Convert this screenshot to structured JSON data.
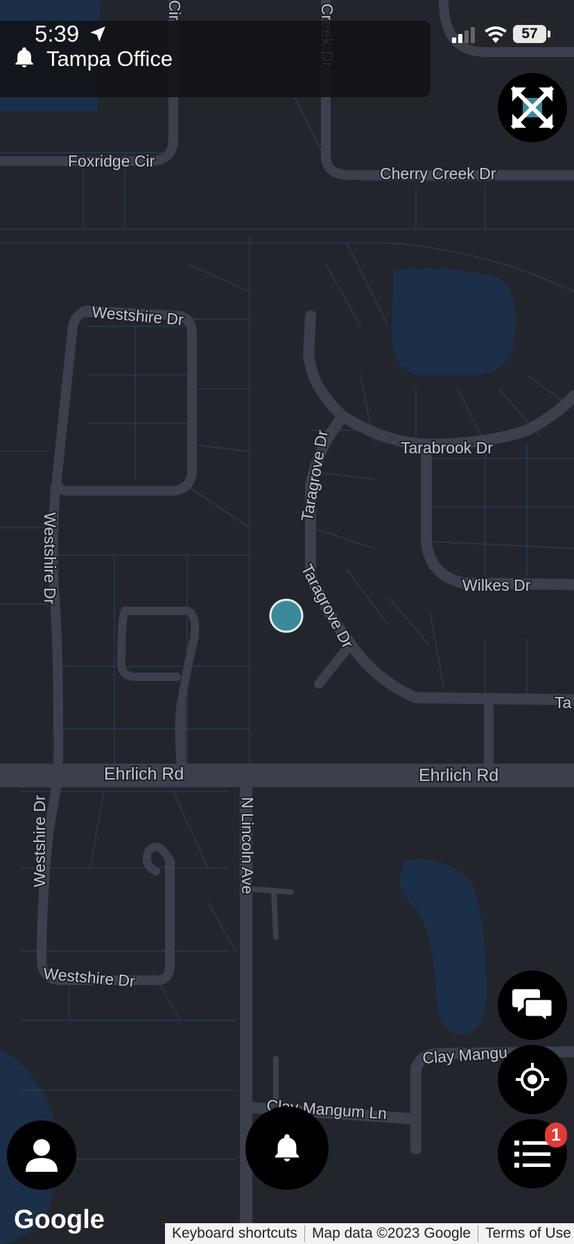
{
  "status_bar": {
    "time": "5:39",
    "battery": "57"
  },
  "header": {
    "title": "Tampa Office"
  },
  "map": {
    "roads": {
      "cir_top": "Cir",
      "creek_dr": "Creek Dr",
      "foxridge_cir": "Foxridge Cir",
      "cherry_creek_dr": "Cherry Creek Dr",
      "westshire_dr_top": "Westshire Dr",
      "westshire_dr_west": "Westshire Dr",
      "westshire_dr_south": "Westshire Dr",
      "westshire_dr_bottom": "Westshire Dr",
      "taragrove_dr_upper": "Taragrove Dr",
      "taragrove_dr_lower": "Taragrove Dr",
      "tarabrook_dr": "Tarabrook Dr",
      "wilkes_dr": "Wilkes Dr",
      "ta_partial": "Ta",
      "ehrlich_rd_west": "Ehrlich Rd",
      "ehrlich_rd_east": "Ehrlich Rd",
      "n_lincoln_ave": "N Lincoln Ave",
      "clay_mangum_east": "Clay Mangu",
      "clay_mangum_ln": "Clay Mangum Ln"
    },
    "colors": {
      "background": "#23252d",
      "road": "#3b404b",
      "water": "#1c2f48",
      "parcel": "#2b3a4f",
      "location_dot": "#3a8a9a"
    }
  },
  "controls": {
    "fullscreen": "fullscreen-button",
    "chat": "chat-button",
    "locate": "locate-button",
    "list": "list-button",
    "list_badge": "1",
    "profile": "profile-button",
    "alert": "alert-button"
  },
  "footer": {
    "google_logo": "Google",
    "keyboard_shortcuts": "Keyboard shortcuts",
    "map_data": "Map data ©2023 Google",
    "terms": "Terms of Use"
  }
}
